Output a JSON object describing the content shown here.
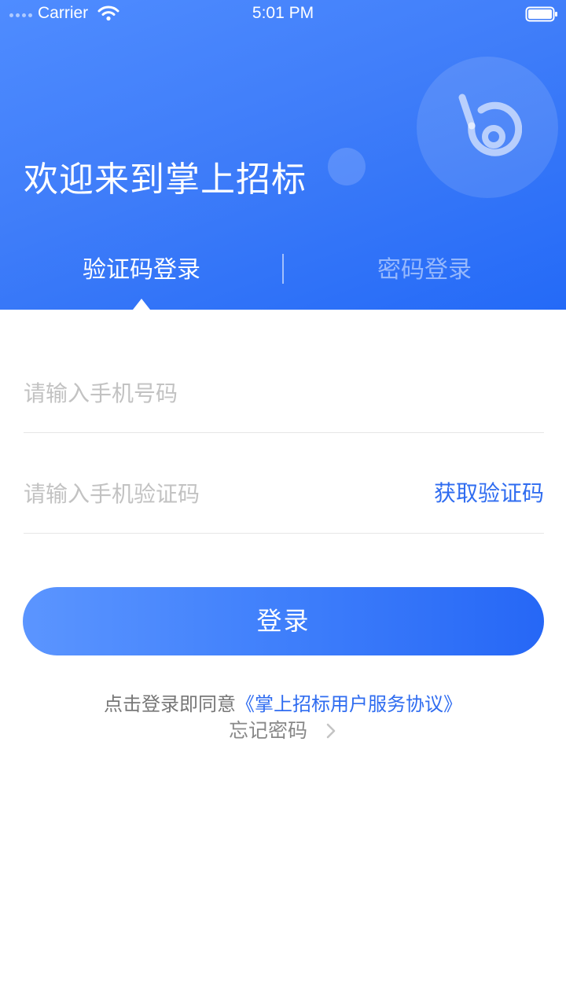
{
  "status_bar": {
    "carrier": "Carrier",
    "time": "5:01 PM",
    "icons": [
      "signal-icon",
      "wifi-icon",
      "battery-icon"
    ]
  },
  "header": {
    "welcome_title": "欢迎来到掌上招标",
    "logo_icon": "logo-icon"
  },
  "tabs": [
    {
      "label": "验证码登录",
      "active": true
    },
    {
      "label": "密码登录",
      "active": false
    }
  ],
  "form": {
    "phone": {
      "value": "",
      "placeholder": "请输入手机号码"
    },
    "code": {
      "value": "",
      "placeholder": "请输入手机验证码"
    },
    "get_code_label": "获取验证码",
    "login_label": "登录"
  },
  "footer": {
    "agreement_prefix": "点击登录即同意",
    "agreement_link": "《掌上招标用户服务协议》",
    "forgot_label": "忘记密码",
    "forgot_icon": "chevron-right-icon"
  },
  "colors": {
    "primary": "#3f7df9",
    "primary_dark": "#246af7",
    "link": "#2f6cf0",
    "placeholder": "#c2c2c2",
    "divider": "#e6e6e6"
  }
}
